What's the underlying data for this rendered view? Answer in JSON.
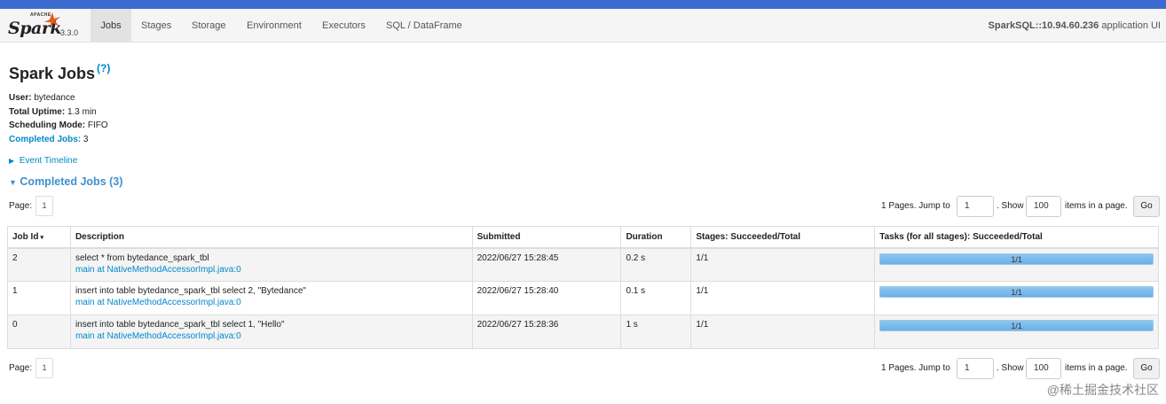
{
  "colors": {
    "accent": "#0088cc",
    "section": "#3d91cf",
    "progress": "#6ab0e6",
    "topstrip": "#3c6bd0"
  },
  "brand": {
    "apache": "APACHE",
    "name": "Spark",
    "version": "3.3.0"
  },
  "nav": {
    "tabs": [
      {
        "label": "Jobs",
        "active": true
      },
      {
        "label": "Stages"
      },
      {
        "label": "Storage"
      },
      {
        "label": "Environment"
      },
      {
        "label": "Executors"
      },
      {
        "label": "SQL / DataFrame"
      }
    ],
    "app_name": "SparkSQL::10.94.60.236",
    "app_suffix": " application UI"
  },
  "page": {
    "title": "Spark Jobs",
    "help": "(?)"
  },
  "summary": {
    "user_label": "User:",
    "user": "bytedance",
    "uptime_label": "Total Uptime:",
    "uptime": "1.3 min",
    "mode_label": "Scheduling Mode:",
    "mode": "FIFO",
    "completed_label": "Completed Jobs:",
    "completed": "3"
  },
  "timeline": {
    "label": "Event Timeline"
  },
  "section": {
    "title": "Completed Jobs (3)"
  },
  "pager": {
    "page_label": "Page:",
    "page_value": "1",
    "pages_text": "1 Pages. Jump to",
    "jump_value": "1",
    "show_text": ". Show",
    "show_value": "100",
    "items_text": "items in a page.",
    "go": "Go"
  },
  "table": {
    "headers": [
      "Job Id",
      "Description",
      "Submitted",
      "Duration",
      "Stages: Succeeded/Total",
      "Tasks (for all stages): Succeeded/Total"
    ],
    "sort_indicator": "▾",
    "rows": [
      {
        "id": "2",
        "desc": "select * from bytedance_spark_tbl",
        "link": "main at NativeMethodAccessorImpl.java:0",
        "submitted": "2022/06/27 15:28:45",
        "duration": "0.2 s",
        "stages": "1/1",
        "tasks": "1/1",
        "progress": 1.0
      },
      {
        "id": "1",
        "desc": "insert into table bytedance_spark_tbl select 2, \"Bytedance\"",
        "link": "main at NativeMethodAccessorImpl.java:0",
        "submitted": "2022/06/27 15:28:40",
        "duration": "0.1 s",
        "stages": "1/1",
        "tasks": "1/1",
        "progress": 1.0
      },
      {
        "id": "0",
        "desc": "insert into table bytedance_spark_tbl select 1, \"Hello\"",
        "link": "main at NativeMethodAccessorImpl.java:0",
        "submitted": "2022/06/27 15:28:36",
        "duration": "1 s",
        "stages": "1/1",
        "tasks": "1/1",
        "progress": 1.0
      }
    ]
  },
  "watermark": "@稀土掘金技术社区"
}
